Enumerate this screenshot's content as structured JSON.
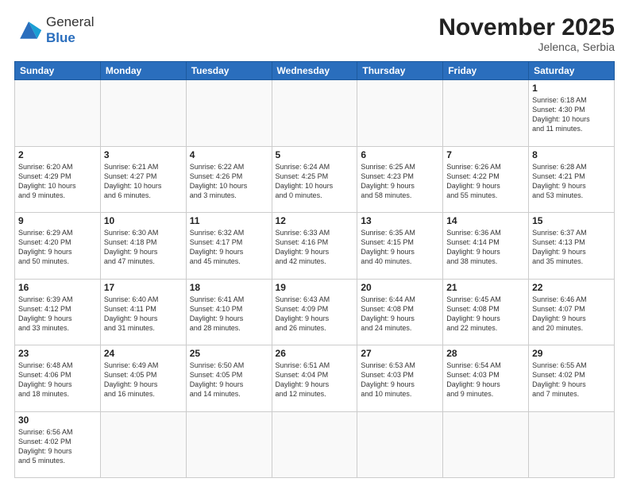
{
  "logo": {
    "text_general": "General",
    "text_blue": "Blue"
  },
  "header": {
    "month_year": "November 2025",
    "location": "Jelenca, Serbia"
  },
  "days_of_week": [
    "Sunday",
    "Monday",
    "Tuesday",
    "Wednesday",
    "Thursday",
    "Friday",
    "Saturday"
  ],
  "weeks": [
    [
      {
        "day": "",
        "info": ""
      },
      {
        "day": "",
        "info": ""
      },
      {
        "day": "",
        "info": ""
      },
      {
        "day": "",
        "info": ""
      },
      {
        "day": "",
        "info": ""
      },
      {
        "day": "",
        "info": ""
      },
      {
        "day": "1",
        "info": "Sunrise: 6:18 AM\nSunset: 4:30 PM\nDaylight: 10 hours\nand 11 minutes."
      }
    ],
    [
      {
        "day": "2",
        "info": "Sunrise: 6:20 AM\nSunset: 4:29 PM\nDaylight: 10 hours\nand 9 minutes."
      },
      {
        "day": "3",
        "info": "Sunrise: 6:21 AM\nSunset: 4:27 PM\nDaylight: 10 hours\nand 6 minutes."
      },
      {
        "day": "4",
        "info": "Sunrise: 6:22 AM\nSunset: 4:26 PM\nDaylight: 10 hours\nand 3 minutes."
      },
      {
        "day": "5",
        "info": "Sunrise: 6:24 AM\nSunset: 4:25 PM\nDaylight: 10 hours\nand 0 minutes."
      },
      {
        "day": "6",
        "info": "Sunrise: 6:25 AM\nSunset: 4:23 PM\nDaylight: 9 hours\nand 58 minutes."
      },
      {
        "day": "7",
        "info": "Sunrise: 6:26 AM\nSunset: 4:22 PM\nDaylight: 9 hours\nand 55 minutes."
      },
      {
        "day": "8",
        "info": "Sunrise: 6:28 AM\nSunset: 4:21 PM\nDaylight: 9 hours\nand 53 minutes."
      }
    ],
    [
      {
        "day": "9",
        "info": "Sunrise: 6:29 AM\nSunset: 4:20 PM\nDaylight: 9 hours\nand 50 minutes."
      },
      {
        "day": "10",
        "info": "Sunrise: 6:30 AM\nSunset: 4:18 PM\nDaylight: 9 hours\nand 47 minutes."
      },
      {
        "day": "11",
        "info": "Sunrise: 6:32 AM\nSunset: 4:17 PM\nDaylight: 9 hours\nand 45 minutes."
      },
      {
        "day": "12",
        "info": "Sunrise: 6:33 AM\nSunset: 4:16 PM\nDaylight: 9 hours\nand 42 minutes."
      },
      {
        "day": "13",
        "info": "Sunrise: 6:35 AM\nSunset: 4:15 PM\nDaylight: 9 hours\nand 40 minutes."
      },
      {
        "day": "14",
        "info": "Sunrise: 6:36 AM\nSunset: 4:14 PM\nDaylight: 9 hours\nand 38 minutes."
      },
      {
        "day": "15",
        "info": "Sunrise: 6:37 AM\nSunset: 4:13 PM\nDaylight: 9 hours\nand 35 minutes."
      }
    ],
    [
      {
        "day": "16",
        "info": "Sunrise: 6:39 AM\nSunset: 4:12 PM\nDaylight: 9 hours\nand 33 minutes."
      },
      {
        "day": "17",
        "info": "Sunrise: 6:40 AM\nSunset: 4:11 PM\nDaylight: 9 hours\nand 31 minutes."
      },
      {
        "day": "18",
        "info": "Sunrise: 6:41 AM\nSunset: 4:10 PM\nDaylight: 9 hours\nand 28 minutes."
      },
      {
        "day": "19",
        "info": "Sunrise: 6:43 AM\nSunset: 4:09 PM\nDaylight: 9 hours\nand 26 minutes."
      },
      {
        "day": "20",
        "info": "Sunrise: 6:44 AM\nSunset: 4:08 PM\nDaylight: 9 hours\nand 24 minutes."
      },
      {
        "day": "21",
        "info": "Sunrise: 6:45 AM\nSunset: 4:08 PM\nDaylight: 9 hours\nand 22 minutes."
      },
      {
        "day": "22",
        "info": "Sunrise: 6:46 AM\nSunset: 4:07 PM\nDaylight: 9 hours\nand 20 minutes."
      }
    ],
    [
      {
        "day": "23",
        "info": "Sunrise: 6:48 AM\nSunset: 4:06 PM\nDaylight: 9 hours\nand 18 minutes."
      },
      {
        "day": "24",
        "info": "Sunrise: 6:49 AM\nSunset: 4:05 PM\nDaylight: 9 hours\nand 16 minutes."
      },
      {
        "day": "25",
        "info": "Sunrise: 6:50 AM\nSunset: 4:05 PM\nDaylight: 9 hours\nand 14 minutes."
      },
      {
        "day": "26",
        "info": "Sunrise: 6:51 AM\nSunset: 4:04 PM\nDaylight: 9 hours\nand 12 minutes."
      },
      {
        "day": "27",
        "info": "Sunrise: 6:53 AM\nSunset: 4:03 PM\nDaylight: 9 hours\nand 10 minutes."
      },
      {
        "day": "28",
        "info": "Sunrise: 6:54 AM\nSunset: 4:03 PM\nDaylight: 9 hours\nand 9 minutes."
      },
      {
        "day": "29",
        "info": "Sunrise: 6:55 AM\nSunset: 4:02 PM\nDaylight: 9 hours\nand 7 minutes."
      }
    ],
    [
      {
        "day": "30",
        "info": "Sunrise: 6:56 AM\nSunset: 4:02 PM\nDaylight: 9 hours\nand 5 minutes."
      },
      {
        "day": "",
        "info": ""
      },
      {
        "day": "",
        "info": ""
      },
      {
        "day": "",
        "info": ""
      },
      {
        "day": "",
        "info": ""
      },
      {
        "day": "",
        "info": ""
      },
      {
        "day": "",
        "info": ""
      }
    ]
  ]
}
